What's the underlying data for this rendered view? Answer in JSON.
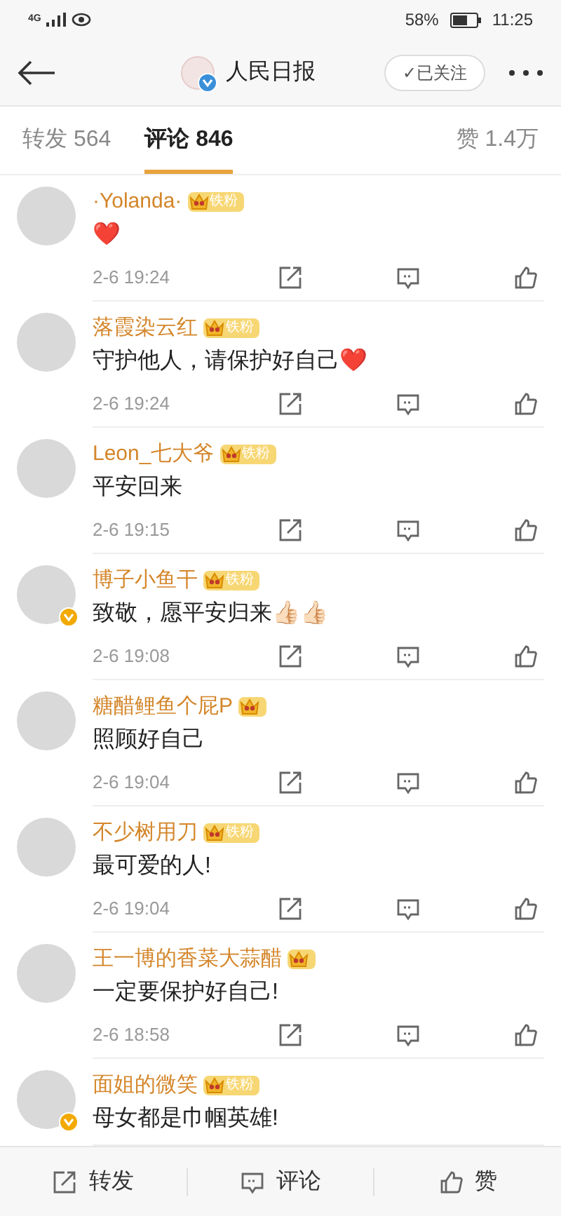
{
  "status_bar": {
    "battery_percent": "58%",
    "time": "11:25",
    "network": "4G"
  },
  "header": {
    "title": "人民日报",
    "verified": true,
    "follow_button": "✓已关注"
  },
  "tabs": [
    {
      "label": "转发 564",
      "selected": false
    },
    {
      "label": "评论 846",
      "selected": true
    },
    {
      "label": "赞 1.4万",
      "selected": false
    }
  ],
  "comments": [
    {
      "user": "·Yolanda·",
      "badge": "铁粉",
      "verified": false,
      "text": "❤️",
      "time": "2-6 19:24"
    },
    {
      "user": "落霞染云红",
      "badge": "铁粉",
      "verified": false,
      "text": "守护他人，请保护好自己❤️",
      "time": "2-6 19:24"
    },
    {
      "user": "Leon_七大爷",
      "badge": "铁粉",
      "verified": false,
      "text": "平安回来",
      "time": "2-6 19:15"
    },
    {
      "user": "博子小鱼干",
      "badge": "铁粉",
      "verified": true,
      "text": "致敬，愿平安归来👍🏻👍🏻",
      "time": "2-6 19:08"
    },
    {
      "user": "糖醋鲤鱼个屁P",
      "verified": false,
      "text": "照顾好自己",
      "time": "2-6 19:04"
    },
    {
      "user": "不少树用刀",
      "badge": "铁粉",
      "verified": false,
      "text": "最可爱的人!",
      "time": "2-6 19:04"
    },
    {
      "user": "王一博的香菜大蒜醋",
      "verified": false,
      "text": "一定要保护好自己!",
      "time": "2-6 18:58"
    },
    {
      "user": "面姐的微笑",
      "badge": "铁粉",
      "verified": true,
      "text": "母女都是巾帼英雄!"
    }
  ],
  "bottom_bar": [
    "转发",
    "评论",
    "赞"
  ]
}
